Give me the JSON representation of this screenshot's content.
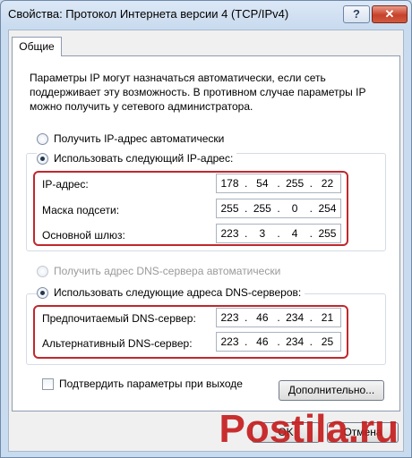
{
  "window": {
    "title": "Свойства: Протокол Интернета версии 4 (TCP/IPv4)",
    "help_glyph": "?",
    "close_glyph": "✕"
  },
  "tabs": [
    {
      "label": "Общие"
    }
  ],
  "description": "Параметры IP могут назначаться автоматически, если сеть поддерживает эту возможность. В противном случае параметры IP можно получить у сетевого администратора.",
  "ip_mode": {
    "auto_label": "Получить IP-адрес автоматически",
    "manual_label": "Использовать следующий IP-адрес:",
    "selected": "manual"
  },
  "ip_fields": [
    {
      "label": "IP-адрес:",
      "octets": [
        "178",
        "54",
        "255",
        "22"
      ]
    },
    {
      "label": "Маска подсети:",
      "octets": [
        "255",
        "255",
        "0",
        "254"
      ]
    },
    {
      "label": "Основной шлюз:",
      "octets": [
        "223",
        "3",
        "4",
        "255"
      ]
    }
  ],
  "dns_mode": {
    "auto_label": "Получить адрес DNS-сервера автоматически",
    "manual_label": "Использовать следующие адреса DNS-серверов:",
    "selected": "manual"
  },
  "dns_fields": [
    {
      "label": "Предпочитаемый DNS-сервер:",
      "octets": [
        "223",
        "46",
        "234",
        "21"
      ]
    },
    {
      "label": "Альтернативный DNS-сервер:",
      "octets": [
        "223",
        "46",
        "234",
        "25"
      ]
    }
  ],
  "validate_checkbox": {
    "label": "Подтвердить параметры при выходе",
    "checked": false
  },
  "buttons": {
    "advanced": "Дополнительно...",
    "ok": "OK",
    "cancel": "Отмена"
  },
  "watermark": {
    "text": "Postila.ru"
  },
  "colors": {
    "highlight_border": "#c0282d",
    "titlebar": "#c9dbef",
    "close_button": "#c6412a"
  }
}
